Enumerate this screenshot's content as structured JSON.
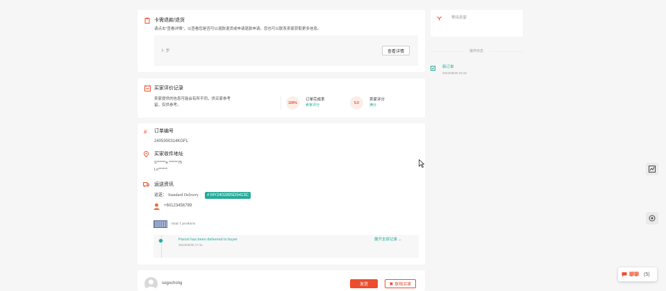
{
  "colors": {
    "accent": "#ee4d2d",
    "teal": "#26aa99",
    "background": "#f6f6f6"
  },
  "notice_card": {
    "title": "卡需退款/退货",
    "desc": "请点击\"查看详情\"，以查看您是否可以退款退货或申请退款申请。您也可以联系卖家获取更多信息。",
    "inner_left": "卜 步",
    "inner_button": "查看详情"
  },
  "buyer_card": {
    "title": "买家评价记录",
    "desc_line1": "卖家提供的信息可能会有所不同，供买家参考",
    "desc_line2": "留，仅供参考。",
    "stat1_badge": "100%",
    "stat1_label": "订单完成率",
    "stat1_sub": "卖家评分",
    "stat2_badge": "5.0",
    "stat2_label": "卖家评分",
    "stat2_sub": "满分"
  },
  "order_card": {
    "order_id_title": "订单编号",
    "order_id": "2405300314KGFL",
    "address_title": "买家收件地址",
    "address_line1": "S******a ******75",
    "address_line2": "Lo******",
    "shipping_title": "运送资讯",
    "carrier_label": "运送：",
    "carrier": "Standard Delivery",
    "tracking_tag": "# MY240289SD5413C",
    "phone": "+60123456789",
    "products": "total 1 products",
    "status_text": "Parcel has been delivered to buyer",
    "status_time": "2024/05/30 17:11",
    "expand_link": "展开全部记录"
  },
  "bottom_card": {
    "username": "sogochong",
    "btn_primary": "发货",
    "btn_secondary": "联络买家"
  },
  "right_panel": {
    "box_label": "等待卖家",
    "section_title": "操作日志",
    "log_title": "新订单",
    "log_time": "2024/05/30 22:32"
  },
  "chat_widget": {
    "label": "聊聊",
    "count": "(5)"
  }
}
